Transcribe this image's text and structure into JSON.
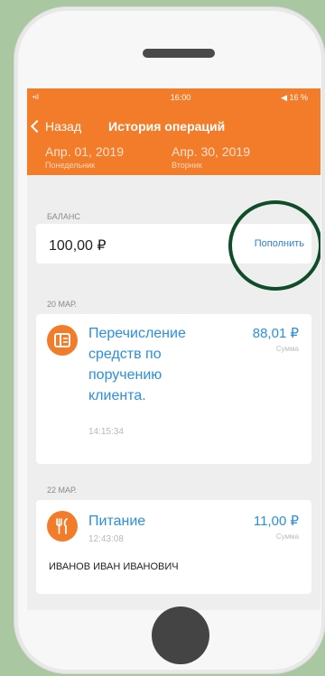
{
  "status_bar": {
    "signal": "•ıl",
    "time": "16:00",
    "battery": "◀ 16 %"
  },
  "nav": {
    "back_label": "Назад",
    "title": "История операций"
  },
  "period": {
    "from_date": "Апр. 01, 2019",
    "from_day": "Понедельник",
    "to_date": "Апр. 30, 2019",
    "to_day": "Вторник"
  },
  "balance": {
    "section_label": "БАЛАНС",
    "value": "100,00 ₽",
    "topup_label": "Пополнить"
  },
  "operations": [
    {
      "date_label": "20 МАР.",
      "title": "Перечисление средств по поручению клиента.",
      "title_lines": [
        "Перечисление",
        "средств по",
        "поручению",
        "клиента."
      ],
      "amount": "88,01 ₽",
      "amount_label": "Сумма",
      "time": "14:15:34",
      "icon": "transfer-icon"
    },
    {
      "date_label": "22 МАР.",
      "title": "Питание",
      "amount": "11,00 ₽",
      "amount_label": "Сумма",
      "time": "12:43:08",
      "person": "ИВАНОВ ИВАН ИВАНОВИЧ",
      "icon": "fork-knife-icon"
    }
  ],
  "colors": {
    "accent": "#f37c2a",
    "link": "#2a80d8",
    "highlight_ring": "#0f4d2a"
  }
}
